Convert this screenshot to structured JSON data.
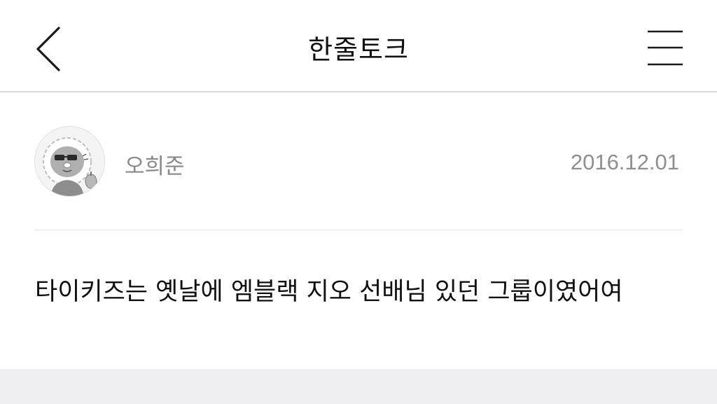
{
  "nav": {
    "title": "한줄토크",
    "back_icon": "chevron-left-icon",
    "menu_icon": "hamburger-menu-icon"
  },
  "post": {
    "author": "오희준",
    "date": "2016.12.01",
    "avatar_icon": "cartoon-avatar-icon",
    "message": "타이키즈는 옛날에 엠블랙 지오 선배님 있던 그룹이였어여"
  },
  "colors": {
    "divider": "#d7d7d7",
    "meta_text": "#8a8a8a",
    "bottom_band": "#efeff1"
  }
}
